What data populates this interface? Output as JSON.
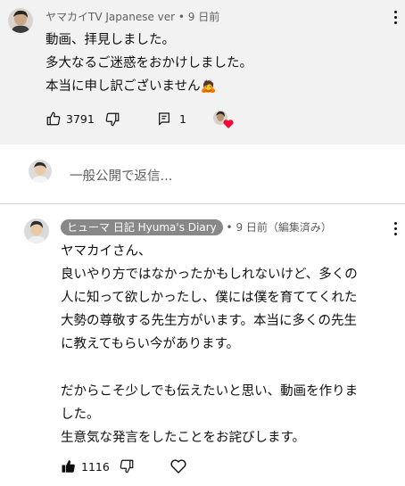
{
  "top_comment": {
    "author": "ヤマカイTV Japanese ver",
    "separator": " • ",
    "time": "9 日前",
    "lines": [
      "動画、拝見しました。",
      "多大なるご迷惑をおかけしました。",
      "本当に申し訳ございません🙇"
    ],
    "like_count": "3791",
    "reply_count": "1",
    "like_icon": "thumbs-up-outline-icon",
    "dislike_icon": "thumbs-down-outline-icon",
    "reply_icon": "reply-comment-icon",
    "hearted_icon": "creator-heart-icon"
  },
  "reply_input": {
    "placeholder": "一般公開で返信..."
  },
  "reply": {
    "author": "ヒューマ 日記 Hyuma's Diary",
    "separator": " • ",
    "time": "9 日前（編集済み）",
    "lines": [
      "ヤマカイさん、",
      "良いやり方ではなかったかもしれないけど、多くの",
      "人に知って欲しかったし、僕には僕を育ててくれた",
      "大勢の尊敬する先生方がいます。本当に多くの先生",
      "に教えてもらい今があります。",
      "だからこそ少しでも伝えたいと思い、動画を作りま",
      "した。",
      "生意気な発言をしたことをお詫びします。"
    ],
    "like_count": "1116",
    "like_icon": "thumbs-up-filled-icon",
    "dislike_icon": "thumbs-down-outline-icon",
    "heart_icon": "heart-outline-icon"
  },
  "colors": {
    "top_background": "#f2f2f2",
    "secondary_text": "#606060",
    "badge_background": "#888888",
    "heart_red": "#ff0033"
  }
}
